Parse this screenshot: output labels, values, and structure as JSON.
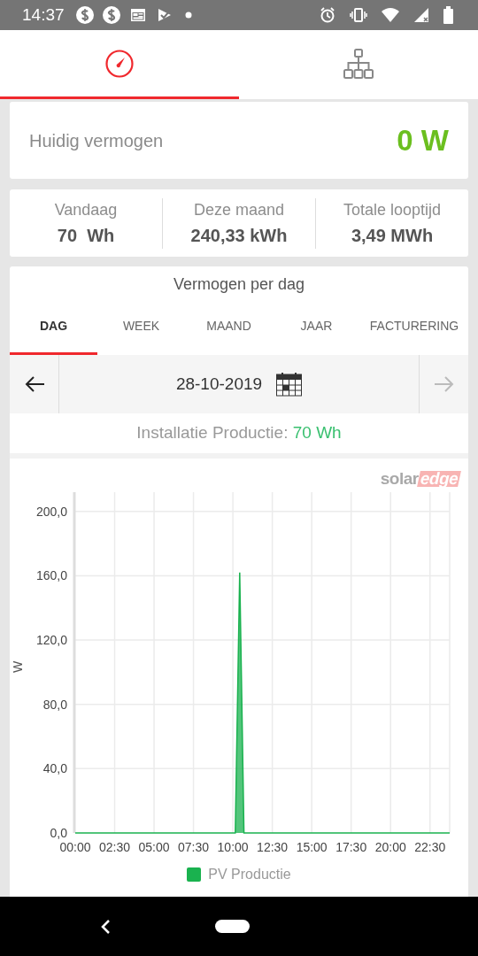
{
  "status_bar": {
    "time": "14:37"
  },
  "top_tabs": [
    {
      "kind": "gauge",
      "selected": true
    },
    {
      "kind": "hierarchy",
      "selected": false
    }
  ],
  "current_power": {
    "label": "Huidig vermogen",
    "value": "0 W"
  },
  "stats": [
    {
      "label": "Vandaag",
      "value": "70  Wh"
    },
    {
      "label": "Deze maand",
      "value": "240,33 kWh"
    },
    {
      "label": "Totale looptijd",
      "value": "3,49 MWh"
    }
  ],
  "panel": {
    "title": "Vermogen per dag",
    "tabs": [
      {
        "label": "DAG",
        "selected": true
      },
      {
        "label": "WEEK",
        "selected": false
      },
      {
        "label": "MAAND",
        "selected": false
      },
      {
        "label": "JAAR",
        "selected": false
      },
      {
        "label": "FACTURERING",
        "selected": false
      }
    ],
    "prev": {
      "disabled": false
    },
    "next": {
      "disabled": true
    },
    "date": "28-10-2019",
    "production_label": "Installatie Productie:",
    "production_value": "70 Wh",
    "logo": {
      "part_1": "solar",
      "part_2": "edge"
    },
    "chart_data": {
      "type": "area",
      "grid": true,
      "ylabel": "W",
      "x": [
        0,
        10.15,
        10.43,
        10.7,
        23.75
      ],
      "series": [
        {
          "name": "PV Productie",
          "color": "#1ab24f",
          "values": [
            0,
            0,
            162,
            0,
            0
          ]
        }
      ],
      "xlim": [
        0,
        23.75
      ],
      "ylim": [
        0,
        212
      ],
      "xticks": [
        {
          "value": 0,
          "label": "00:00"
        },
        {
          "value": 2.5,
          "label": "02:30"
        },
        {
          "value": 5,
          "label": "05:00"
        },
        {
          "value": 7.5,
          "label": "07:30"
        },
        {
          "value": 10,
          "label": "10:00"
        },
        {
          "value": 12.5,
          "label": "12:30"
        },
        {
          "value": 15,
          "label": "15:00"
        },
        {
          "value": 17.5,
          "label": "17:30"
        },
        {
          "value": 20,
          "label": "20:00"
        },
        {
          "value": 22.5,
          "label": "22:30"
        }
      ],
      "yticks": [
        {
          "value": 0,
          "label": "0,0"
        },
        {
          "value": 40,
          "label": "40,0"
        },
        {
          "value": 80,
          "label": "80,0"
        },
        {
          "value": 120,
          "label": "120,0"
        },
        {
          "value": 160,
          "label": "160,0"
        },
        {
          "value": 200,
          "label": "200,0"
        }
      ]
    }
  }
}
